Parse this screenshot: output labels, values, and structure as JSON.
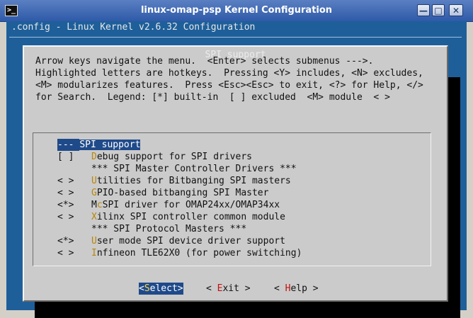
{
  "window": {
    "title": "linux-omap-psp Kernel Configuration",
    "icon": "terminal-icon",
    "icon_glyph": ">_"
  },
  "terminal": {
    "header": ".config - Linux Kernel v2.6.32 Configuration",
    "dialog_title": "SPI support",
    "help_lines": [
      "Arrow keys navigate the menu.  <Enter> selects submenus --->.",
      "Highlighted letters are hotkeys.  Pressing <Y> includes, <N> excludes,",
      "<M> modularizes features.  Press <Esc><Esc> to exit, <?> for Help, </>",
      "for Search.  Legend: [*] built-in  [ ] excluded  <M> module  < >"
    ],
    "menu_items": [
      {
        "state": "--- ",
        "hot": "S",
        "rest": "PI support",
        "selected": true
      },
      {
        "state": "[ ]",
        "hot": "D",
        "rest": "ebug support for SPI drivers"
      },
      {
        "state": "",
        "comment": "*** SPI Master Controller Drivers ***"
      },
      {
        "state": "< >",
        "hot": "U",
        "rest": "tilities for Bitbanging SPI masters"
      },
      {
        "state": "< >",
        "hot": "G",
        "rest": "PIO-based bitbanging SPI Master"
      },
      {
        "state": "<*>",
        "pre": "M",
        "hot": "c",
        "rest": "SPI driver for OMAP24xx/OMAP34xx"
      },
      {
        "state": "< >",
        "hot": "X",
        "rest": "ilinx SPI controller common module"
      },
      {
        "state": "",
        "comment": "*** SPI Protocol Masters ***"
      },
      {
        "state": "<*>",
        "hot": "U",
        "rest": "ser mode SPI device driver support"
      },
      {
        "state": "< >",
        "hot": "I",
        "rest": "nfineon TLE62X0 (for power switching)"
      }
    ],
    "buttons": {
      "select": {
        "open": "<",
        "hot": "S",
        "rest": "elect",
        "close": ">"
      },
      "exit": {
        "open": "< ",
        "hot": "E",
        "rest": "xit",
        "close": " >"
      },
      "help": {
        "open": "< ",
        "hot": "H",
        "rest": "elp",
        "close": " >"
      }
    }
  }
}
